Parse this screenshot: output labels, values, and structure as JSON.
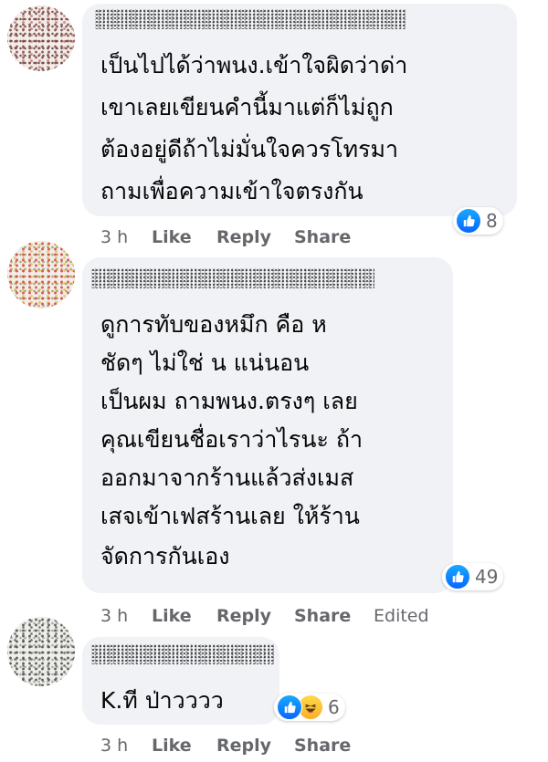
{
  "comments": [
    {
      "text_lines": [
        "เป็นไปได้ว่าพนง.เข้าใจผิดว่าด่า",
        "เขาเลยเขียนคำนี้มาแต่ก็ไม่ถูก",
        "ต้องอยู่ดีถ้าไม่มั่นใจควรโทรมา",
        "ถามเพื่อความเข้าใจตรงกัน"
      ],
      "time": "3 h",
      "like_label": "Like",
      "reply_label": "Reply",
      "share_label": "Share",
      "reaction_count": "8",
      "reactions": [
        "like-icon"
      ]
    },
    {
      "text_lines": [
        "ดูการทับของหมึก คือ ห",
        "ชัดๆ ไม่ใช่ น แน่นอน",
        "เป็นผม ถามพนง.ตรงๆ เลย",
        "คุณเขียนชื่อเราว่าไรนะ ถ้า",
        "ออกมาจากร้านแล้วส่งเมส",
        "เสจเข้าเฟสร้านเลย ให้ร้าน",
        "จัดการกันเอง"
      ],
      "time": "3 h",
      "like_label": "Like",
      "reply_label": "Reply",
      "share_label": "Share",
      "edited_label": "Edited",
      "reaction_count": "49",
      "reactions": [
        "like-icon"
      ]
    },
    {
      "text_lines": [
        "K.ที ป่าวววว"
      ],
      "time": "3 h",
      "like_label": "Like",
      "reply_label": "Reply",
      "share_label": "Share",
      "reaction_count": "6",
      "reactions": [
        "like-icon",
        "haha-icon"
      ]
    }
  ],
  "colors": {
    "bubble": "#f0f2f5",
    "meta_text": "#65676b",
    "like_blue": "#0866ff",
    "haha_yellow": "#f7b125"
  }
}
